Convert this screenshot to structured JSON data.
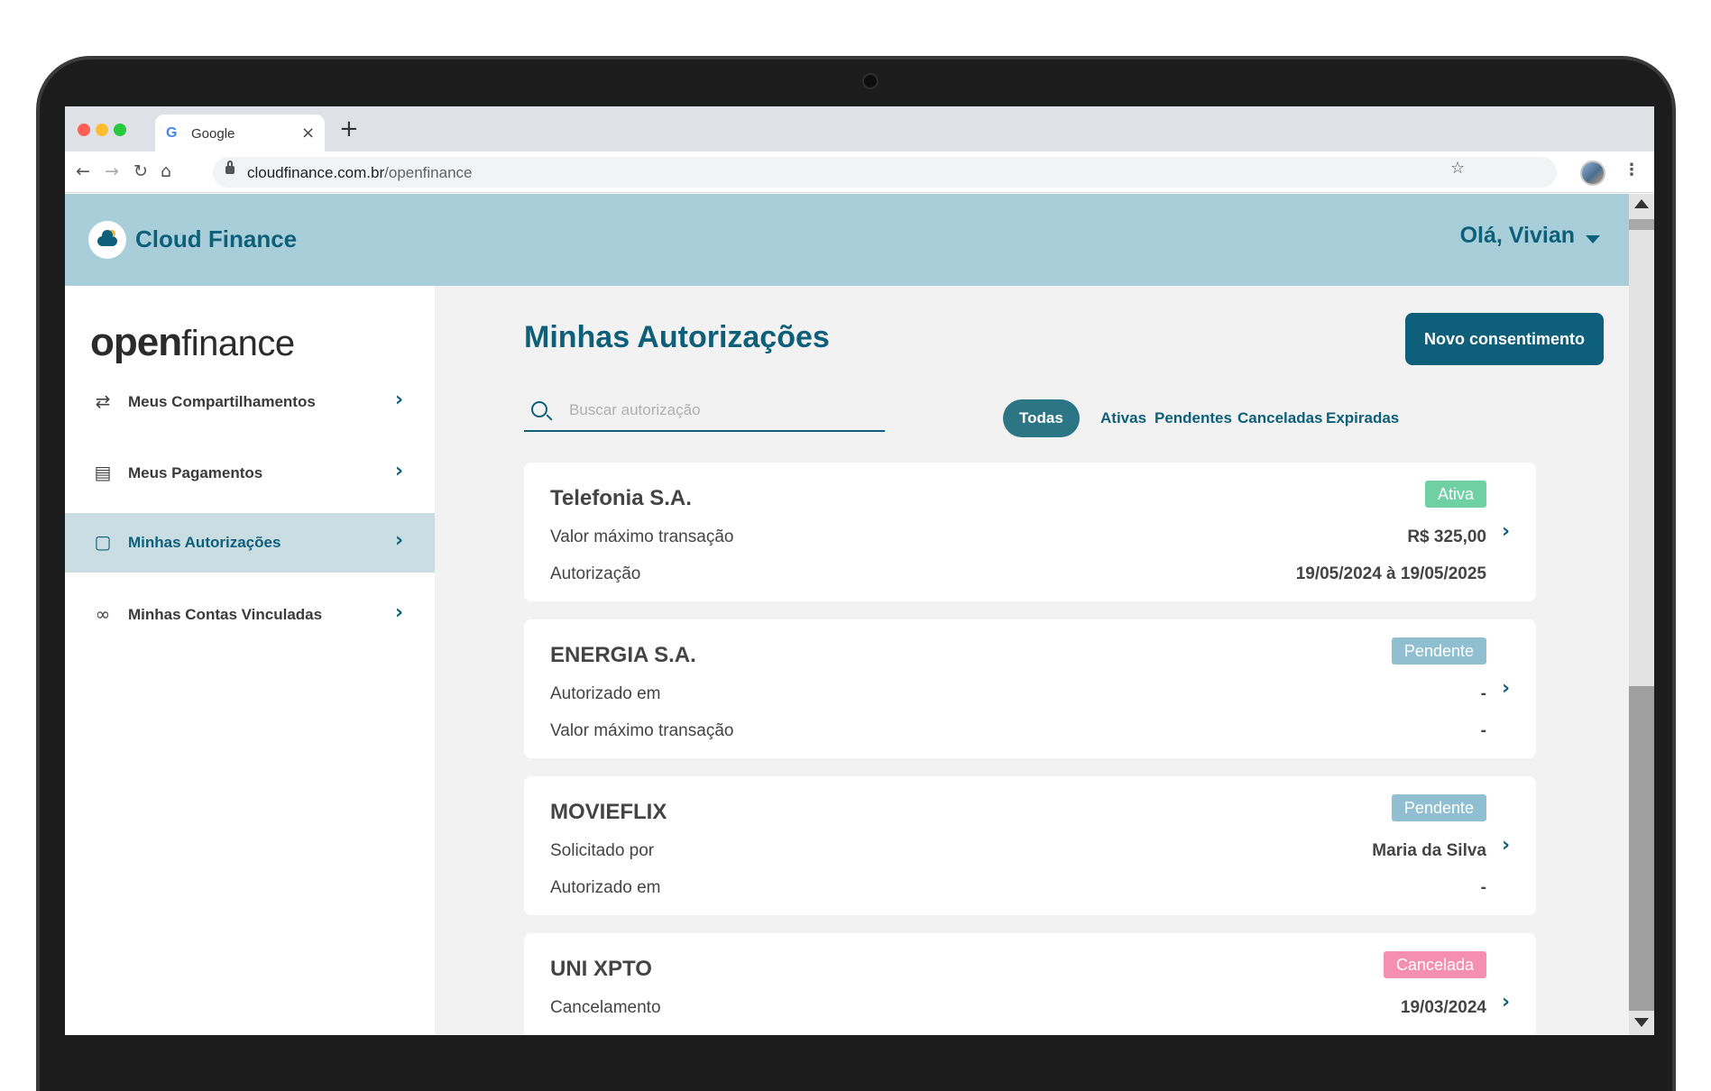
{
  "browser": {
    "tab_title": "Google",
    "tab_favicon": "G",
    "tab_close": "×",
    "new_tab": "+",
    "url_host": "cloudfinance.com.br",
    "url_path": "/openfinance"
  },
  "header": {
    "brand": "Cloud Finance",
    "greeting": "Olá, Vivian"
  },
  "sidebar": {
    "logo_bold": "open",
    "logo_light": "finance",
    "items": [
      {
        "label": "Meus Compartilhamentos",
        "icon": "sync-icon",
        "active": false
      },
      {
        "label": "Meus Pagamentos",
        "icon": "payment-icon",
        "active": false
      },
      {
        "label": "Minhas Autorizações",
        "icon": "document-check-icon",
        "active": true
      },
      {
        "label": "Minhas Contas Vinculadas",
        "icon": "link-icon",
        "active": false
      }
    ]
  },
  "main": {
    "title": "Minhas Autorizações",
    "cta_label": "Novo consentimento",
    "search_placeholder": "Buscar autorização",
    "filters": [
      "Todas",
      "Ativas",
      "Pendentes",
      "Canceladas",
      "Expiradas"
    ],
    "active_filter": "Todas",
    "cards": [
      {
        "title": "Telefonia S.A.",
        "badge": "Ativa",
        "badge_color": "#6fd0a3",
        "rows": [
          {
            "label": "Valor máximo transação",
            "value": "R$ 325,00"
          },
          {
            "label": "Autorização",
            "value": "19/05/2024 à 19/05/2025"
          }
        ]
      },
      {
        "title": "ENERGIA S.A.",
        "badge": "Pendente",
        "badge_color": "#8fbfd0",
        "rows": [
          {
            "label": "Autorizado em",
            "value": "-"
          },
          {
            "label": "Valor máximo transação",
            "value": "-"
          }
        ]
      },
      {
        "title": "MOVIEFLIX",
        "badge": "Pendente",
        "badge_color": "#8fbfd0",
        "rows": [
          {
            "label": "Solicitado por",
            "value": "Maria da Silva"
          },
          {
            "label": "Autorizado em",
            "value": "-"
          }
        ]
      },
      {
        "title": "UNI XPTO",
        "badge": "Cancelada",
        "badge_color": "#f48fb1",
        "rows": [
          {
            "label": "Cancelamento",
            "value": "19/03/2024"
          }
        ]
      }
    ]
  },
  "colors": {
    "primary": "#0d5f7a",
    "header_bg": "#a8cfd9",
    "active_filter_bg": "#2c7585",
    "sidebar_active_bg": "#c9dde3"
  }
}
